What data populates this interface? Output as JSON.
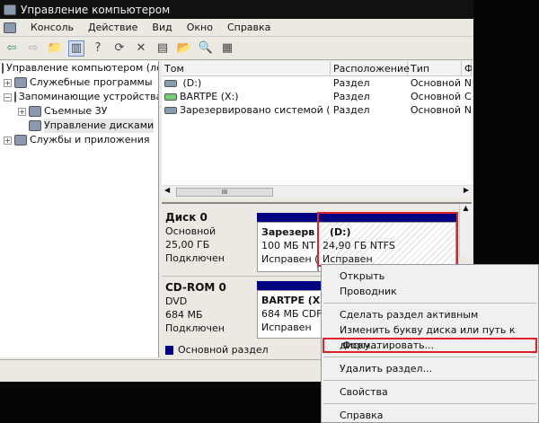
{
  "title": "Управление компьютером",
  "menu": [
    "Консоль",
    "Действие",
    "Вид",
    "Окно",
    "Справка"
  ],
  "tree": [
    {
      "label": "Управление компьютером (лс",
      "level": 0,
      "toggle": ""
    },
    {
      "label": "Служебные программы",
      "level": 1,
      "toggle": "+"
    },
    {
      "label": "Запоминающие устройства",
      "level": 1,
      "toggle": "−"
    },
    {
      "label": "Съемные ЗУ",
      "level": 2,
      "toggle": "+"
    },
    {
      "label": "Управление дисками",
      "level": 2,
      "toggle": ""
    },
    {
      "label": "Службы и приложения",
      "level": 1,
      "toggle": "+"
    }
  ],
  "list": {
    "headers": [
      "Том",
      "Расположение",
      "Тип",
      "Ф"
    ],
    "rows": [
      [
        "(D:)",
        "Раздел",
        "Основной",
        "N"
      ],
      [
        "BARTPE (X:)",
        "Раздел",
        "Основной",
        "C"
      ],
      [
        "Зарезервировано системой (C:)",
        "Раздел",
        "Основной",
        "N"
      ]
    ],
    "scroll_thumb": "III"
  },
  "disks": [
    {
      "name": "Диск 0",
      "type": "Основной",
      "size": "25,00 ГБ",
      "state": "Подключен",
      "parts": [
        {
          "name": "Зарезерв",
          "info": "100 МБ NT",
          "state": "Исправен ("
        },
        {
          "name": "(D:)",
          "info": "24,90 ГБ NTFS",
          "state": "Исправен"
        }
      ]
    },
    {
      "name": "CD-ROM 0",
      "type": "DVD",
      "size": "684 МБ",
      "state": "Подключен",
      "parts": [
        {
          "name": "BARTPE  (X:",
          "info": "684 МБ CDFS",
          "state": "Исправен"
        }
      ]
    }
  ],
  "legend": "Основной раздел",
  "context_menu": [
    "Открыть",
    "Проводник",
    "Сделать раздел активным",
    "Изменить букву диска или путь к диску...",
    "Форматировать...",
    "Удалить раздел...",
    "Свойства",
    "Справка"
  ],
  "colors": {
    "partition_bar": "#000080",
    "highlight": "#e0202a"
  }
}
